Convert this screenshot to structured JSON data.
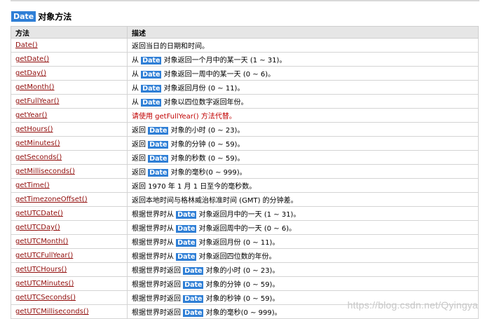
{
  "heading": {
    "badge": "Date",
    "title": "对象方法"
  },
  "table": {
    "headers": [
      "方法",
      "描述"
    ],
    "rows": [
      {
        "method": "Date()",
        "pre": "返回当日的日期和时间。",
        "hl": "",
        "post": "",
        "warn": false
      },
      {
        "method": "getDate()",
        "pre": "从 ",
        "hl": "Date",
        "post": " 对象返回一个月中的某一天 (1 ~ 31)。",
        "warn": false
      },
      {
        "method": "getDay()",
        "pre": "从 ",
        "hl": "Date",
        "post": " 对象返回一周中的某一天 (0 ~ 6)。",
        "warn": false
      },
      {
        "method": "getMonth()",
        "pre": "从 ",
        "hl": "Date",
        "post": " 对象返回月份 (0 ~ 11)。",
        "warn": false
      },
      {
        "method": "getFullYear()",
        "pre": "从 ",
        "hl": "Date",
        "post": " 对象以四位数字返回年份。",
        "warn": false
      },
      {
        "method": "getYear()",
        "pre": "请使用 getFullYear() 方法代替。",
        "hl": "",
        "post": "",
        "warn": true
      },
      {
        "method": "getHours()",
        "pre": "返回 ",
        "hl": "Date",
        "post": " 对象的小时 (0 ~ 23)。",
        "warn": false
      },
      {
        "method": "getMinutes()",
        "pre": "返回 ",
        "hl": "Date",
        "post": " 对象的分钟 (0 ~ 59)。",
        "warn": false
      },
      {
        "method": "getSeconds()",
        "pre": "返回 ",
        "hl": "Date",
        "post": " 对象的秒数 (0 ~ 59)。",
        "warn": false
      },
      {
        "method": "getMilliseconds()",
        "pre": "返回 ",
        "hl": "Date",
        "post": " 对象的毫秒(0 ~ 999)。",
        "warn": false
      },
      {
        "method": "getTime()",
        "pre": "返回 1970 年 1 月 1 日至今的毫秒数。",
        "hl": "",
        "post": "",
        "warn": false
      },
      {
        "method": "getTimezoneOffset()",
        "pre": "返回本地时间与格林威治标准时间 (GMT) 的分钟差。",
        "hl": "",
        "post": "",
        "warn": false
      },
      {
        "method": "getUTCDate()",
        "pre": "根据世界时从 ",
        "hl": "Date",
        "post": " 对象返回月中的一天 (1 ~ 31)。",
        "warn": false
      },
      {
        "method": "getUTCDay()",
        "pre": "根据世界时从 ",
        "hl": "Date",
        "post": " 对象返回周中的一天 (0 ~ 6)。",
        "warn": false
      },
      {
        "method": "getUTCMonth()",
        "pre": "根据世界时从 ",
        "hl": "Date",
        "post": " 对象返回月份 (0 ~ 11)。",
        "warn": false
      },
      {
        "method": "getUTCFullYear()",
        "pre": "根据世界时从 ",
        "hl": "Date",
        "post": " 对象返回四位数的年份。",
        "warn": false
      },
      {
        "method": "getUTCHours()",
        "pre": "根据世界时返回 ",
        "hl": "Date",
        "post": " 对象的小时 (0 ~ 23)。",
        "warn": false
      },
      {
        "method": "getUTCMinutes()",
        "pre": "根据世界时返回 ",
        "hl": "Date",
        "post": " 对象的分钟 (0 ~ 59)。",
        "warn": false
      },
      {
        "method": "getUTCSeconds()",
        "pre": "根据世界时返回 ",
        "hl": "Date",
        "post": " 对象的秒钟 (0 ~ 59)。",
        "warn": false
      },
      {
        "method": "getUTCMilliseconds()",
        "pre": "根据世界时返回 ",
        "hl": "Date",
        "post": " 对象的毫秒(0 ~ 999)。",
        "warn": false
      }
    ]
  },
  "watermark": "https://blog.csdn.net/Qyingya",
  "colors": {
    "highlight": "#2f7fd6",
    "method_link": "#900b09",
    "warning": "#c00000",
    "header_bg": "#e6e6e6"
  }
}
